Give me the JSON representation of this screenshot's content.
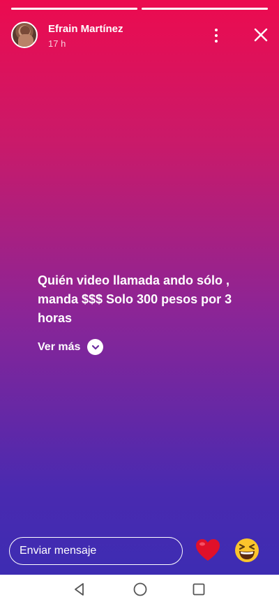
{
  "story": {
    "progress": [
      {
        "fraction": 1.0
      },
      {
        "fraction": 1.0
      }
    ],
    "author": {
      "name": "Efrain Martínez",
      "time": "17 h"
    },
    "caption": "Quién video llamada ando sólo , manda $$$ Solo 300 pesos por 3 horas",
    "see_more": "Ver más",
    "reply": {
      "placeholder": "Enviar mensaje"
    },
    "reactions": [
      "heart-emoji",
      "grinning-squinting-face-emoji",
      "emoji-partial"
    ]
  },
  "colors": {
    "gradient_top": "#ec0b4f",
    "gradient_bottom": "#3d2cb2",
    "heart": "#e0102a",
    "emoji_yellow": "#fbc42c"
  },
  "icons": {
    "menu": "kebab-menu-icon",
    "close": "close-icon",
    "see_more": "chevron-down-icon",
    "nav_back": "triangle-back-icon",
    "nav_home": "circle-home-icon",
    "nav_recent": "square-recents-icon"
  }
}
